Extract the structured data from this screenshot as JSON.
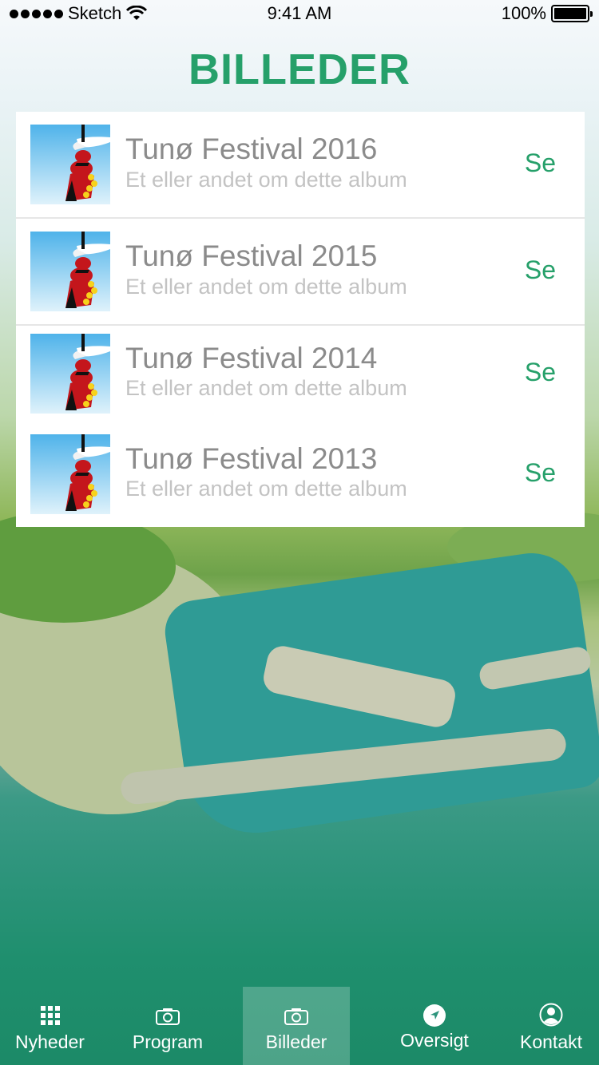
{
  "status_bar": {
    "carrier": "Sketch",
    "time": "9:41 AM",
    "battery": "100%"
  },
  "page": {
    "title": "BILLEDER"
  },
  "albums": [
    {
      "title": "Tunø Festival 2016",
      "subtitle": "Et eller andet om dette album",
      "action": "Se"
    },
    {
      "title": "Tunø Festival 2015",
      "subtitle": "Et eller andet om dette album",
      "action": "Se"
    },
    {
      "title": "Tunø Festival 2014",
      "subtitle": "Et eller andet om dette album",
      "action": "Se"
    },
    {
      "title": "Tunø Festival 2013",
      "subtitle": "Et eller andet om dette album",
      "action": "Se"
    }
  ],
  "tab_bar": {
    "tabs": [
      {
        "label": "Nyheder",
        "icon": "grid-icon"
      },
      {
        "label": "Program",
        "icon": "camera-icon"
      },
      {
        "label": "Billeder",
        "icon": "camera-icon",
        "active": true
      },
      {
        "label": "Oversigt",
        "icon": "navigation-icon"
      },
      {
        "label": "Kontakt",
        "icon": "user-icon"
      }
    ]
  },
  "colors": {
    "accent": "#26a06a",
    "title_text": "#8b8b8b",
    "subtitle_text": "#c3c3c3"
  }
}
